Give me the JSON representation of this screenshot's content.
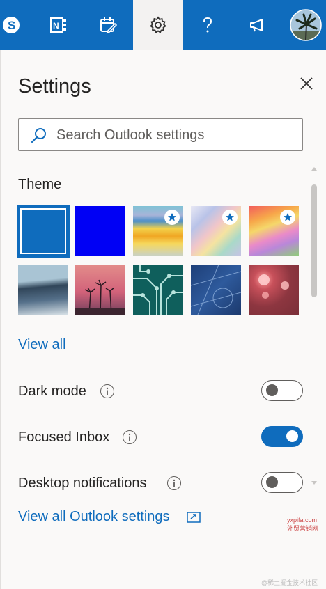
{
  "topbar": {
    "icons": [
      "skype-icon",
      "onenote-icon",
      "my-day-icon",
      "settings-gear-icon",
      "help-icon",
      "feedback-megaphone-icon",
      "avatar"
    ],
    "bg_color": "#0f6cbd"
  },
  "panel": {
    "title": "Settings",
    "search_placeholder": "Search Outlook settings",
    "theme_heading": "Theme",
    "themes": [
      {
        "name": "blue",
        "color": "#0f6cbd",
        "selected": true
      },
      {
        "name": "bright-blue",
        "color": "#0000f5"
      },
      {
        "name": "rainbow-wave",
        "starred": true
      },
      {
        "name": "pastel-ribbon",
        "starred": true
      },
      {
        "name": "unicorn",
        "starred": true
      },
      {
        "name": "mountain-sea"
      },
      {
        "name": "palm-sunset"
      },
      {
        "name": "circuit-board"
      },
      {
        "name": "blueprint"
      },
      {
        "name": "bokeh-lights"
      }
    ],
    "view_all": "View all",
    "settings": [
      {
        "label": "Dark mode",
        "on": false
      },
      {
        "label": "Focused Inbox",
        "on": true
      },
      {
        "label": "Desktop notifications",
        "on": false
      }
    ],
    "view_all_settings": "View all Outlook settings"
  },
  "watermarks": {
    "site": "yxpifa.com",
    "site_sub": "外贸营销网",
    "credit": "@稀土掘金技术社区"
  }
}
